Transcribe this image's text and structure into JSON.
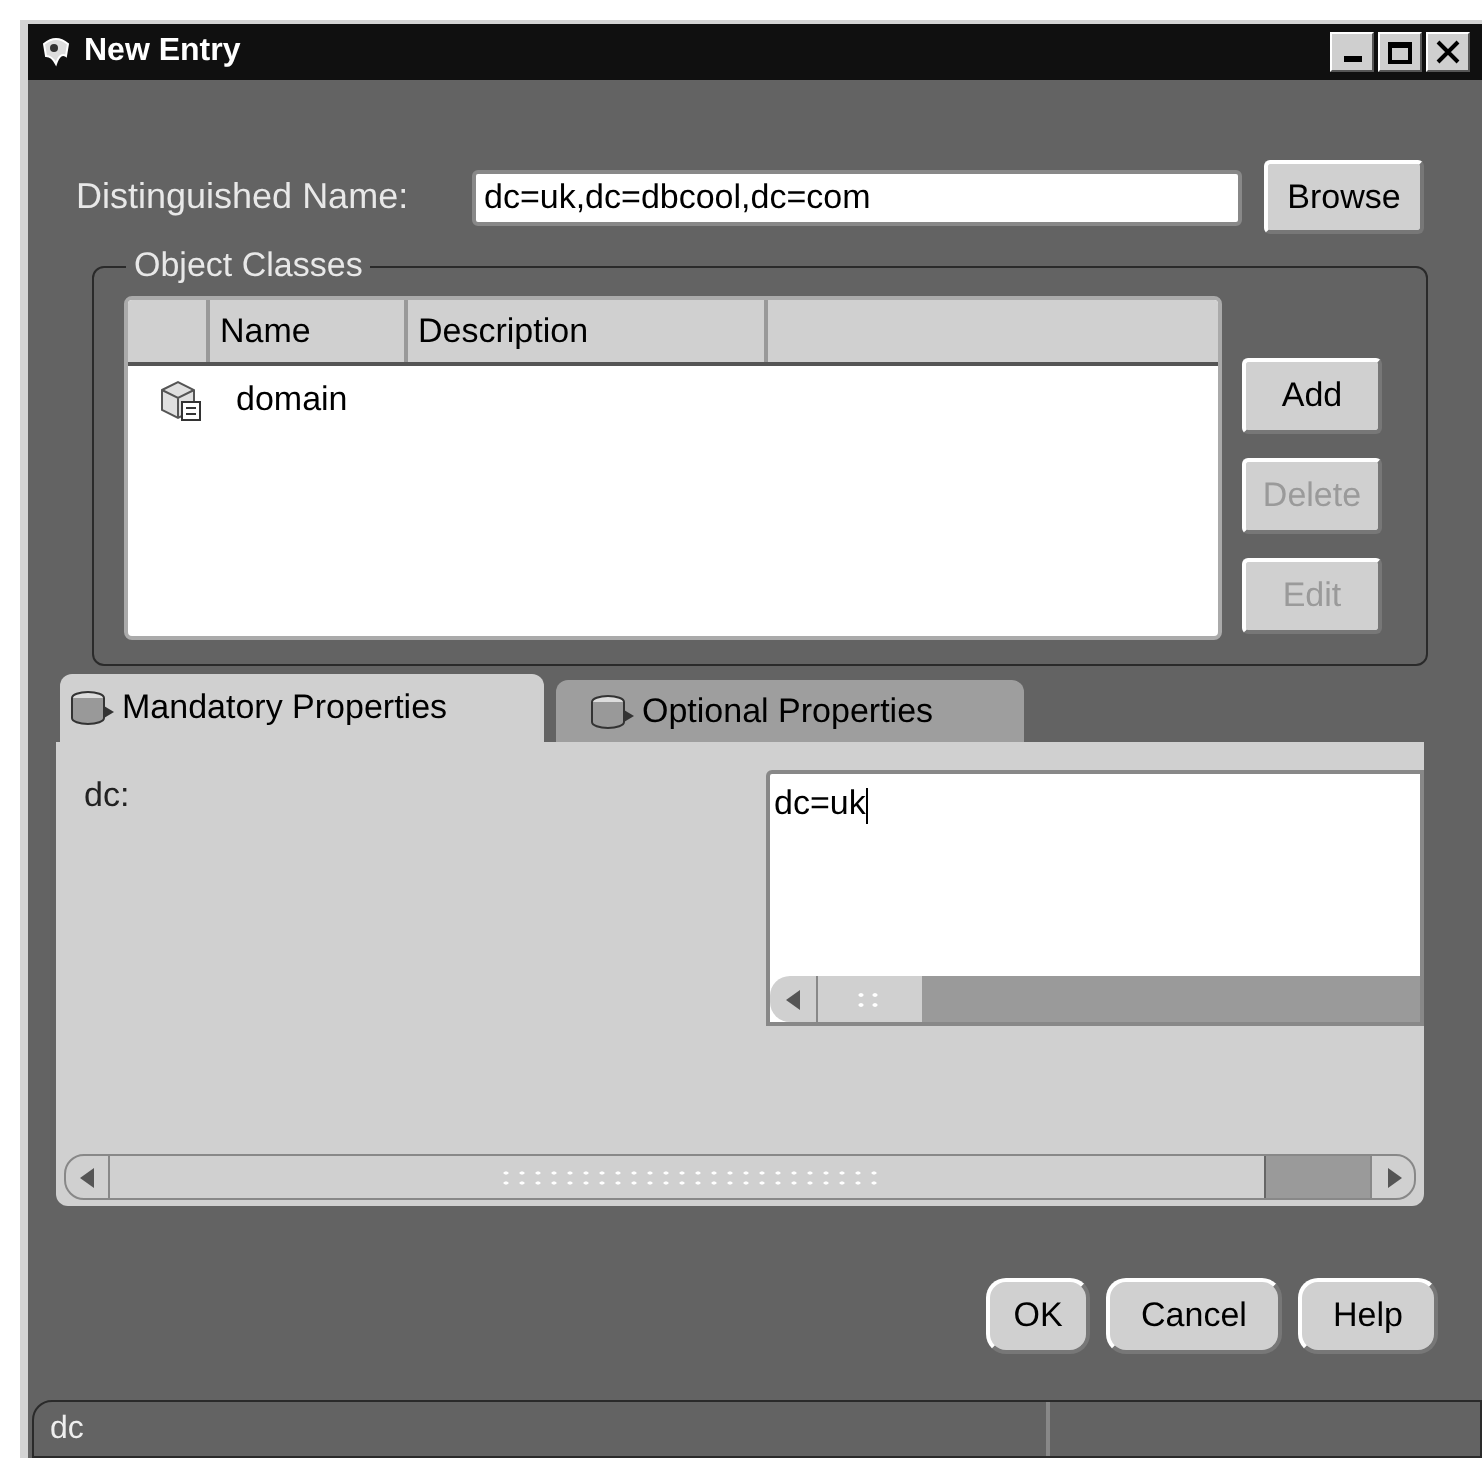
{
  "window": {
    "title": "New Entry"
  },
  "distinguished_name": {
    "label": "Distinguished Name:",
    "value": "dc=uk,dc=dbcool,dc=com"
  },
  "browse_button": {
    "label": "Browse",
    "disabled": false
  },
  "object_classes": {
    "title": "Object Classes",
    "columns": [
      "Name",
      "Description"
    ],
    "rows": [
      {
        "name": "domain"
      }
    ],
    "buttons": [
      {
        "label": "Add",
        "disabled": false
      },
      {
        "label": "Delete",
        "disabled": true
      },
      {
        "label": "Edit",
        "disabled": true
      }
    ]
  },
  "tabs": [
    {
      "label": "Mandatory Properties",
      "selected": true
    },
    {
      "label": "Optional Properties",
      "selected": false
    }
  ],
  "properties": [
    {
      "label": "dc:",
      "value": "dc=uk"
    }
  ],
  "buttons": [
    {
      "label": "OK",
      "disabled": false
    },
    {
      "label": "Cancel",
      "disabled": false
    },
    {
      "label": "Help",
      "disabled": false
    }
  ],
  "status_bar": {
    "text": "dc"
  }
}
